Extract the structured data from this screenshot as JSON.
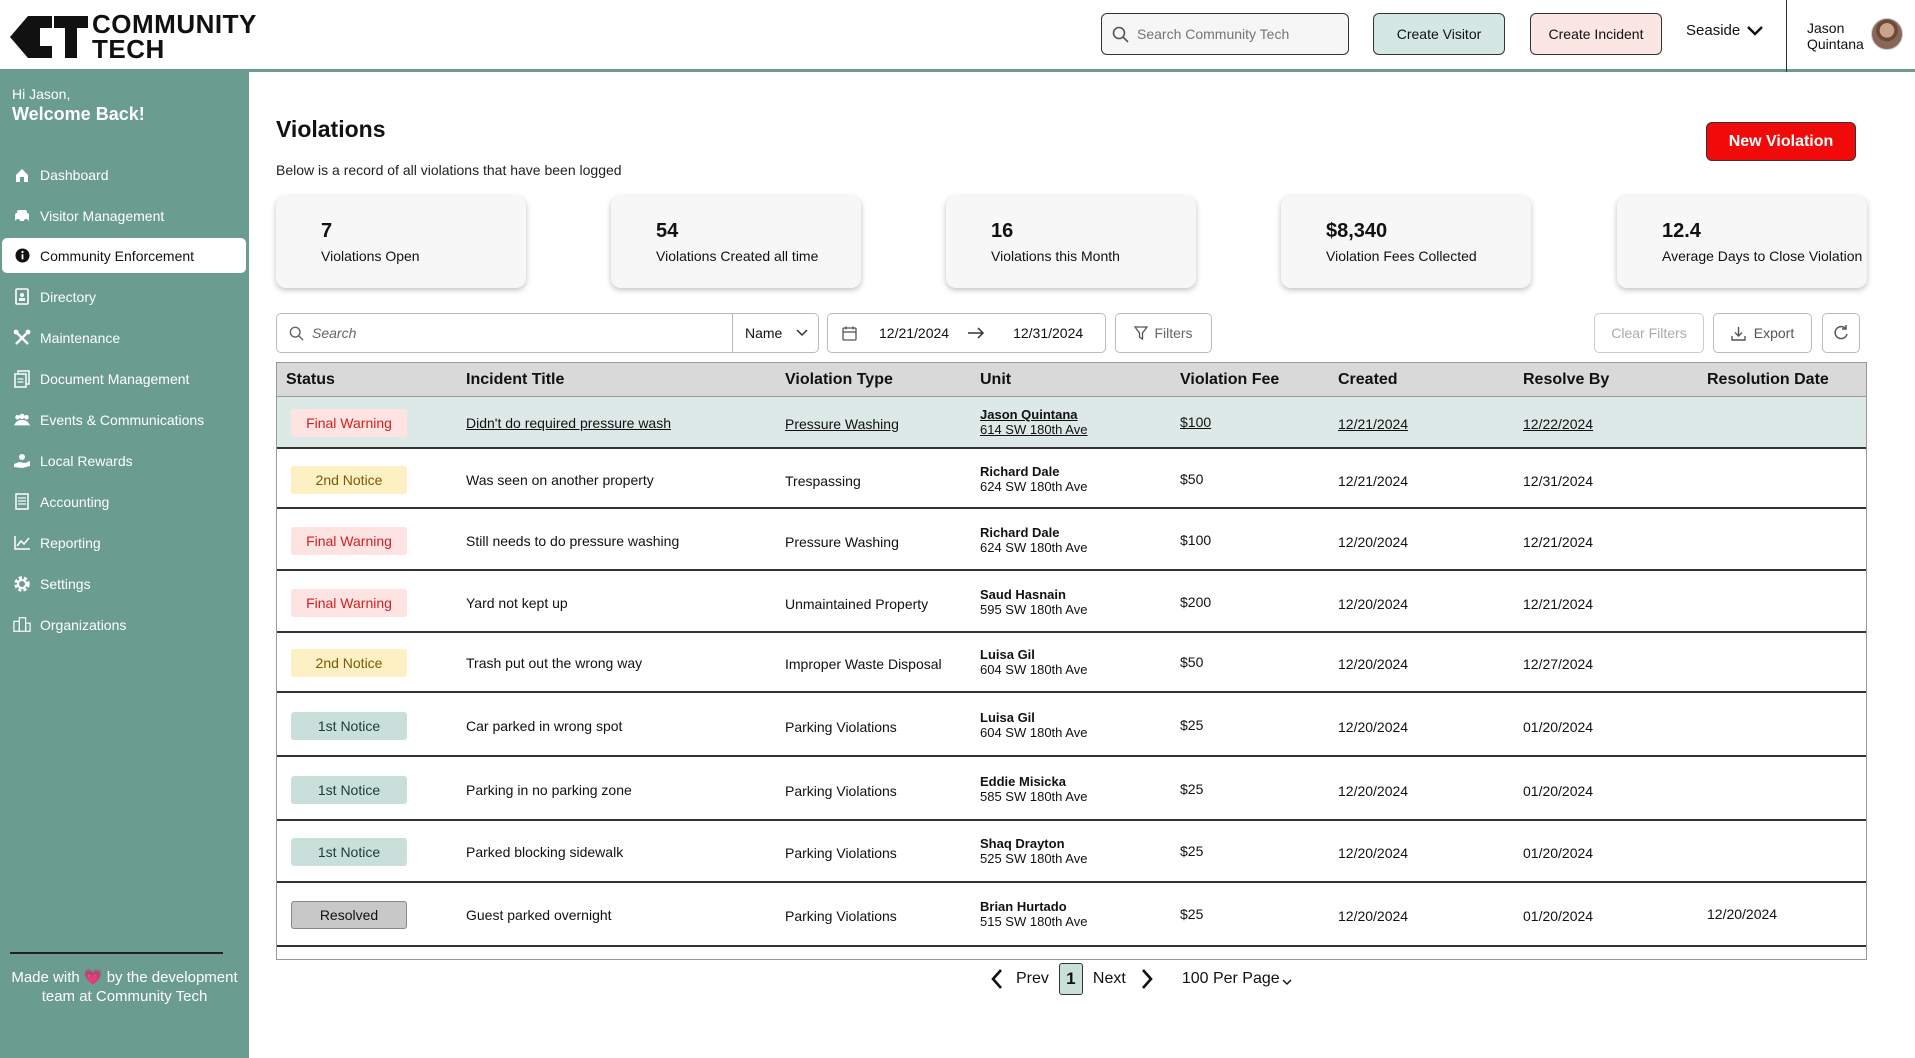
{
  "brand": {
    "line1": "COMMUNITY",
    "line2": "TECH"
  },
  "header": {
    "search_placeholder": "Search Community Tech",
    "create_visitor": "Create Visitor",
    "create_incident": "Create Incident",
    "community": "Seaside",
    "user_first": "Jason",
    "user_last": "Quintana"
  },
  "sidebar": {
    "greeting": "Hi Jason,",
    "welcome": "Welcome Back!",
    "items": [
      {
        "label": "Dashboard",
        "icon": "home-icon"
      },
      {
        "label": "Visitor Management",
        "icon": "car-icon"
      },
      {
        "label": "Community Enforcement",
        "icon": "info-icon",
        "active": true
      },
      {
        "label": "Directory",
        "icon": "contact-book-icon"
      },
      {
        "label": "Maintenance",
        "icon": "tools-icon"
      },
      {
        "label": "Document Management",
        "icon": "documents-icon"
      },
      {
        "label": "Events & Communications",
        "icon": "people-icon"
      },
      {
        "label": "Local Rewards",
        "icon": "hand-gift-icon"
      },
      {
        "label": "Accounting",
        "icon": "ledger-icon"
      },
      {
        "label": "Reporting",
        "icon": "chart-icon"
      },
      {
        "label": "Settings",
        "icon": "gear-icon"
      },
      {
        "label": "Organizations",
        "icon": "buildings-icon"
      }
    ],
    "footer": "Made with 💗 by the development team at Community Tech"
  },
  "main": {
    "title": "Violations",
    "subtitle": "Below is a record of all violations that have been logged",
    "new_button": "New Violation",
    "stats": [
      {
        "value": "7",
        "label": "Violations Open"
      },
      {
        "value": "54",
        "label": "Violations Created all time"
      },
      {
        "value": "16",
        "label": "Violations this Month"
      },
      {
        "value": "$8,340",
        "label": "Violation Fees Collected"
      },
      {
        "value": "12.4",
        "label": "Average Days to Close Violation"
      }
    ],
    "filters": {
      "search_placeholder": "Search",
      "sort_field": "Name",
      "date_from": "12/21/2024",
      "date_to": "12/31/2024",
      "filters_label": "Filters",
      "clear_label": "Clear Filters",
      "export_label": "Export"
    },
    "table": {
      "columns": [
        "Status",
        "Incident Title",
        "Violation Type",
        "Unit",
        "Violation Fee",
        "Created",
        "Resolve By",
        "Resolution Date"
      ],
      "rows": [
        {
          "status": "Final Warning",
          "kind": "final",
          "title": "Didn't do required pressure wash",
          "type": "Pressure Washing",
          "name": "Jason Quintana",
          "addr": "614 SW 180th Ave",
          "fee": "$100",
          "created": "12/21/2024",
          "resolve_by": "12/22/2024",
          "resolution": ""
        },
        {
          "status": "2nd Notice",
          "kind": "second",
          "title": "Was seen on another property",
          "type": "Trespassing",
          "name": "Richard Dale",
          "addr": "624 SW 180th Ave",
          "fee": "$50",
          "created": "12/21/2024",
          "resolve_by": "12/31/2024",
          "resolution": ""
        },
        {
          "status": "Final Warning",
          "kind": "final",
          "title": "Still needs to do pressure washing",
          "type": "Pressure Washing",
          "name": "Richard Dale",
          "addr": "624 SW 180th Ave",
          "fee": "$100",
          "created": "12/20/2024",
          "resolve_by": "12/21/2024",
          "resolution": ""
        },
        {
          "status": "Final Warning",
          "kind": "final",
          "title": "Yard not kept up",
          "type": "Unmaintained Property",
          "name": "Saud Hasnain",
          "addr": "595 SW 180th Ave",
          "fee": "$200",
          "created": "12/20/2024",
          "resolve_by": "12/21/2024",
          "resolution": ""
        },
        {
          "status": "2nd Notice",
          "kind": "second",
          "title": "Trash put out the wrong way",
          "type": "Improper Waste Disposal",
          "name": "Luisa Gil",
          "addr": "604 SW 180th Ave",
          "fee": "$50",
          "created": "12/20/2024",
          "resolve_by": "12/27/2024",
          "resolution": ""
        },
        {
          "status": "1st Notice",
          "kind": "first",
          "title": "Car parked in wrong spot",
          "type": "Parking Violations",
          "name": "Luisa Gil",
          "addr": "604 SW 180th Ave",
          "fee": "$25",
          "created": "12/20/2024",
          "resolve_by": "01/20/2024",
          "resolution": ""
        },
        {
          "status": "1st Notice",
          "kind": "first",
          "title": "Parking in no parking zone",
          "type": "Parking Violations",
          "name": "Eddie Misicka",
          "addr": "585 SW 180th Ave",
          "fee": "$25",
          "created": "12/20/2024",
          "resolve_by": "01/20/2024",
          "resolution": ""
        },
        {
          "status": "1st Notice",
          "kind": "first",
          "title": "Parked blocking sidewalk",
          "type": "Parking Violations",
          "name": "Shaq Drayton",
          "addr": "525 SW 180th Ave",
          "fee": "$25",
          "created": "12/20/2024",
          "resolve_by": "01/20/2024",
          "resolution": ""
        },
        {
          "status": "Resolved",
          "kind": "resolved",
          "title": "Guest parked overnight",
          "type": "Parking Violations",
          "name": "Brian Hurtado",
          "addr": "515 SW 180th Ave",
          "fee": "$25",
          "created": "12/20/2024",
          "resolve_by": "01/20/2024",
          "resolution": "12/20/2024"
        }
      ]
    },
    "pagination": {
      "prev": "Prev",
      "page": "1",
      "next": "Next",
      "per_page": "100 Per Page"
    }
  },
  "colors": {
    "sidebar": "#6a9c90",
    "danger": "#f20a0a",
    "final_badge": "#fde4e3",
    "second_badge": "#fdf0c2",
    "first_badge": "#c9e0da",
    "resolved_badge": "#c8c8c8"
  }
}
